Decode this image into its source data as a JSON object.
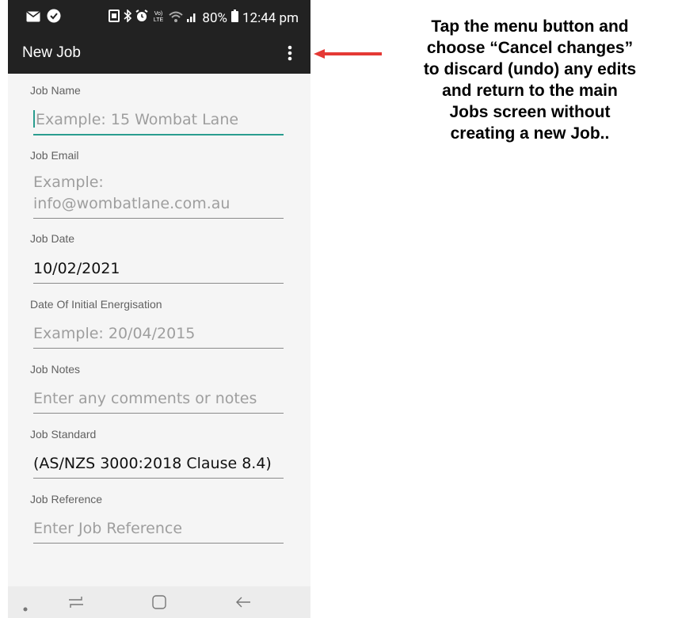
{
  "status_bar": {
    "battery_percent": "80%",
    "time": "12:44 pm",
    "icons": [
      "mail-icon",
      "check-circle-icon",
      "screenshot-icon",
      "bluetooth-icon",
      "alarm-icon",
      "volte-icon",
      "wifi-icon",
      "signal-icon",
      "battery-icon"
    ]
  },
  "app_bar": {
    "title": "New Job",
    "menu_icon": "more-vert-icon"
  },
  "form": {
    "fields": [
      {
        "label": "Job Name",
        "value": "Example: 15 Wombat Lane",
        "is_placeholder": true,
        "focused": true
      },
      {
        "label": "Job Email",
        "value_line1": "Example:",
        "value_line2": "info@wombatlane.com.au",
        "is_placeholder": true
      },
      {
        "label": "Job Date",
        "value": "10/02/2021",
        "is_placeholder": false
      },
      {
        "label": "Date Of Initial Energisation",
        "value": "Example: 20/04/2015",
        "is_placeholder": true
      },
      {
        "label": "Job Notes",
        "value": "Enter any comments or notes",
        "is_placeholder": true
      },
      {
        "label": "Job Standard",
        "value": "(AS/NZS 3000:2018 Clause 8.4)",
        "is_placeholder": false
      },
      {
        "label": "Job Reference",
        "value": "Enter Job Reference",
        "is_placeholder": true
      }
    ]
  },
  "nav_bar": {
    "icons": [
      "dot-icon",
      "recents-icon",
      "home-icon",
      "back-icon"
    ]
  },
  "annotation": {
    "text_lines": [
      "Tap the menu button and",
      "choose “Cancel changes”",
      "to discard (undo) any edits",
      "and return to the main",
      "Jobs screen without",
      "creating a new Job.."
    ],
    "arrow_color": "#e53935"
  },
  "colors": {
    "app_bar": "#222222",
    "accent": "#2a9d8f",
    "background": "#f5f5f5"
  }
}
